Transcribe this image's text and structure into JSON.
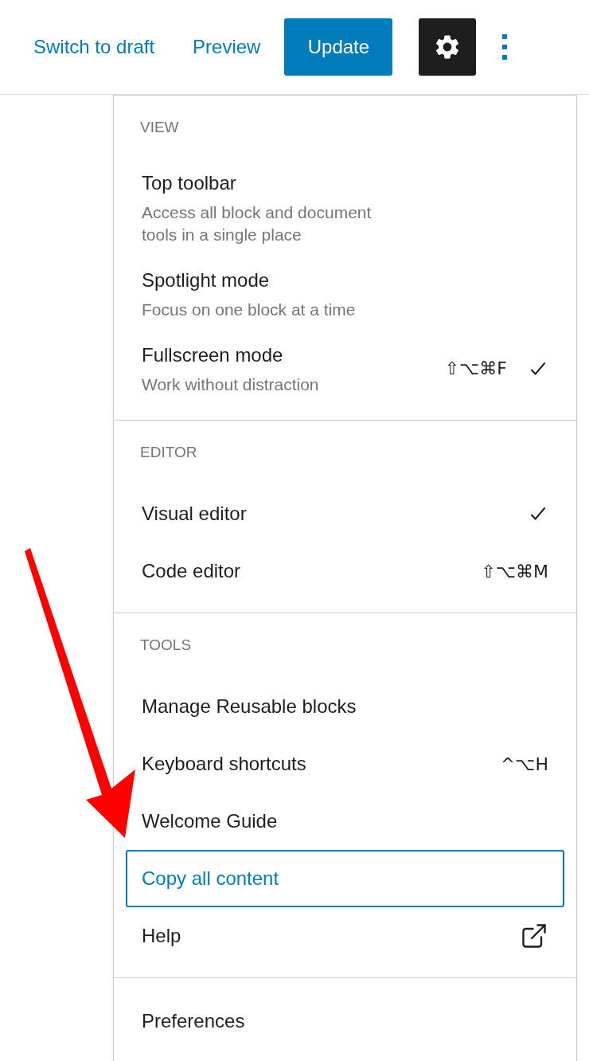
{
  "header": {
    "links": [
      "Switch to draft",
      "Preview"
    ],
    "primary_button": "Update",
    "settings_selected": true
  },
  "menu": {
    "sections": [
      {
        "label": "VIEW",
        "items": [
          {
            "kind": "toggle",
            "label": "Top toolbar",
            "description": "Access all block and document tools in a single place",
            "checked": false
          },
          {
            "kind": "toggle",
            "label": "Spotlight mode",
            "description": "Focus on one block at a time",
            "checked": false
          },
          {
            "kind": "toggle",
            "label": "Fullscreen mode",
            "description": "Work without distraction",
            "shortcut": "⇧⌥⌘F",
            "checked": true
          }
        ]
      },
      {
        "label": "EDITOR",
        "items": [
          {
            "kind": "option",
            "label": "Visual editor",
            "checked": true
          },
          {
            "kind": "option",
            "label": "Code editor",
            "shortcut": "⇧⌥⌘M",
            "checked": false
          }
        ]
      },
      {
        "label": "TOOLS",
        "items": [
          {
            "kind": "action",
            "label": "Manage Reusable blocks",
            "focused": false
          },
          {
            "kind": "action",
            "label": "Keyboard shortcuts",
            "shortcut": "^⌥H",
            "focused": false
          },
          {
            "kind": "action",
            "label": "Welcome Guide",
            "focused": false
          },
          {
            "kind": "action",
            "label": "Copy all content",
            "focused": true
          },
          {
            "kind": "link",
            "label": "Help",
            "focused": false
          }
        ]
      },
      {
        "items": [
          {
            "kind": "action",
            "label": "Preferences",
            "focused": false
          }
        ]
      }
    ]
  }
}
